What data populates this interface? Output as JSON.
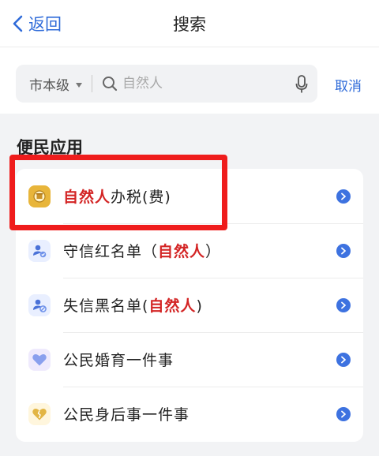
{
  "nav": {
    "back_label": "返回",
    "title": "搜索"
  },
  "search": {
    "level": "市本级",
    "placeholder": "自然人",
    "value": "",
    "cancel_label": "取消"
  },
  "section": {
    "title": "便民应用"
  },
  "apps": [
    {
      "parts": [
        "自然人",
        "办税(费)"
      ]
    },
    {
      "parts": [
        "守信红名单（",
        "自然人",
        "）"
      ]
    },
    {
      "parts": [
        "失信黑名单(",
        "自然人",
        ")"
      ]
    },
    {
      "label": "公民婚育一件事"
    },
    {
      "label": "公民身后事一件事"
    }
  ],
  "colors": {
    "accent": "#2f6bd9",
    "highlight": "#d32424",
    "annotation": "#ef1c1c",
    "chevron": "#3d72e0",
    "tax_icon": "#e8b53a"
  },
  "icons": [
    "chevron-left-icon",
    "search-icon",
    "microphone-icon",
    "tax-bureau-icon",
    "user-shield-icon",
    "user-blocked-icon",
    "heart-icon",
    "broken-heart-icon",
    "chevron-right-icon"
  ]
}
